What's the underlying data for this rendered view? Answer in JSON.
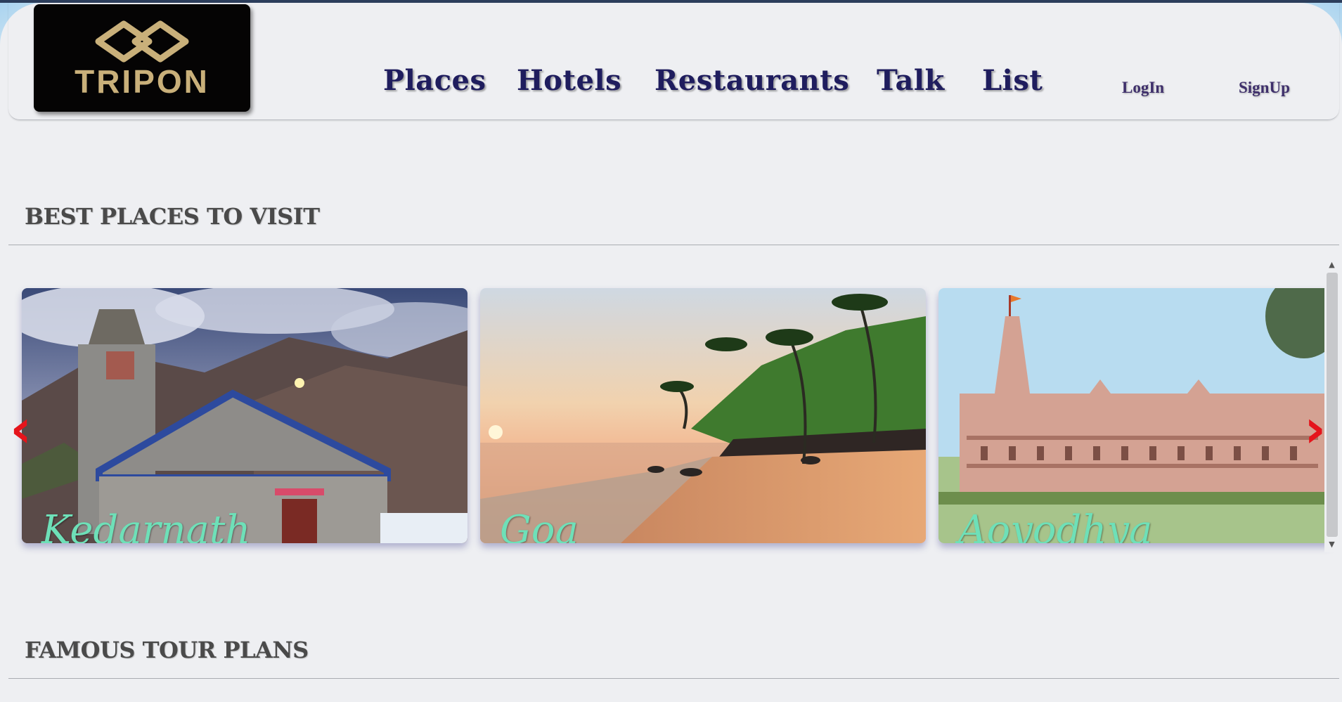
{
  "logo": {
    "text": "TRIPON",
    "gold": "#c9b07a"
  },
  "nav": {
    "items": [
      {
        "label": "Places"
      },
      {
        "label": "Hotels"
      },
      {
        "label": "Restaurants"
      },
      {
        "label": "Talk"
      },
      {
        "label": "List"
      }
    ],
    "login": "LogIn",
    "signup": "SignUp"
  },
  "sections": {
    "best_places": "BEST PLACES TO VISIT",
    "famous_tours": "FAMOUS TOUR PLANS"
  },
  "carousel": {
    "prev_icon": "‹",
    "next_icon": "›",
    "cards": [
      {
        "label": "Kedarnath"
      },
      {
        "label": "Goa"
      },
      {
        "label": "Aoyodhya"
      }
    ]
  },
  "colors": {
    "nav_text": "#1f1d5e",
    "card_label": "#6ee0b8",
    "arrow": "#e5141b"
  }
}
